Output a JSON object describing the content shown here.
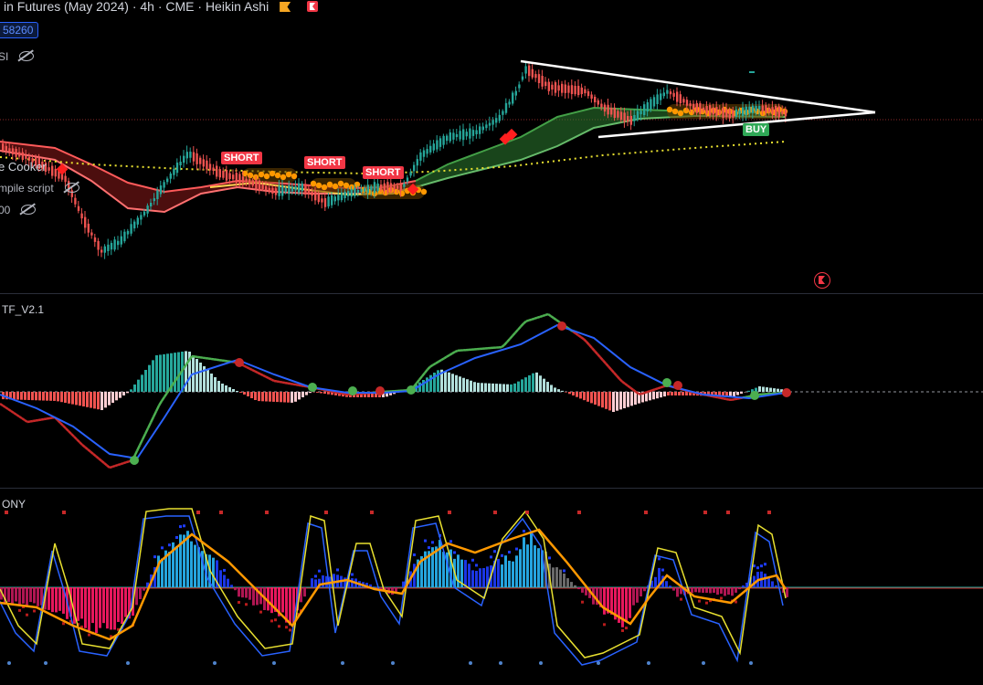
{
  "chart": {
    "title": "in Futures (May 2024) · 4h · CME · Heikin Ashi",
    "price_badge": "58260",
    "indicators": [
      {
        "label": "SI"
      },
      {
        "label": "e Cooker"
      },
      {
        "label": "mpile script"
      },
      {
        "label": "00"
      }
    ],
    "signals": [
      {
        "type": "short",
        "label": "SHORT"
      },
      {
        "type": "short",
        "label": "SHORT"
      },
      {
        "type": "short",
        "label": "SHORT"
      },
      {
        "type": "buy",
        "label": "BUY"
      }
    ],
    "panes": {
      "macd_label": "TF_V2.1",
      "osc_label": "ONY"
    },
    "colors": {
      "background": "#000000",
      "bull": "#26a69a",
      "bear": "#ef5350",
      "accent_blue": "#2962ff",
      "trendline": "#ffffff",
      "orange": "#ff9800",
      "yellow_dots": "#e8e030",
      "cloud_green": "#2e7d32",
      "cloud_red": "#8b1a1a"
    }
  }
}
